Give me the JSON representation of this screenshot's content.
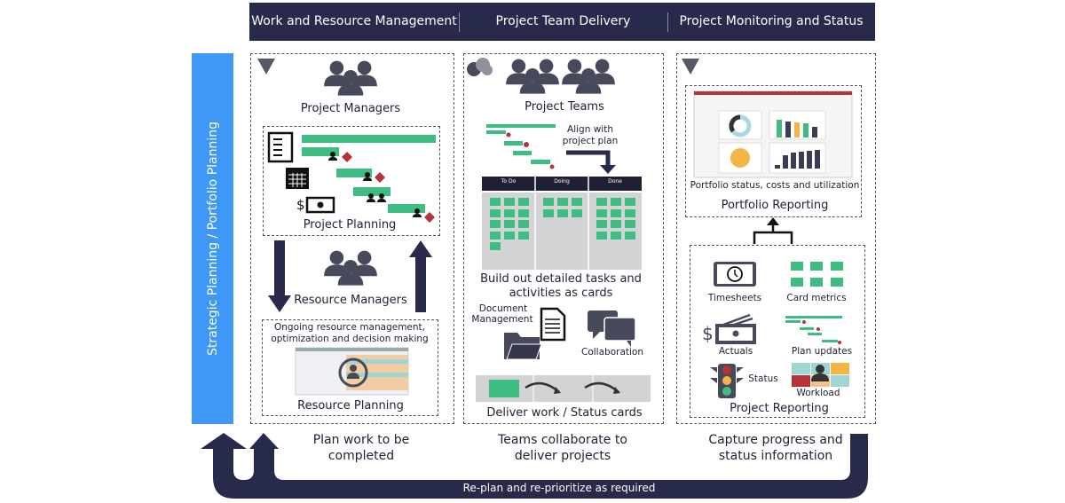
{
  "header": {
    "columns": [
      "Work and Resource Management",
      "Project Team Delivery",
      "Project Monitoring and Status"
    ]
  },
  "sidebar": {
    "label": "Strategic Planning / Portfolio Planning"
  },
  "col1": {
    "project_managers": "Project Managers",
    "project_planning": "Project Planning",
    "resource_managers": "Resource Managers",
    "resource_desc_1": "Ongoing resource management,",
    "resource_desc_2": "optimization and decision making",
    "resource_planning": "Resource Planning",
    "caption_1": "Plan work to be",
    "caption_2": "completed"
  },
  "col2": {
    "project_teams": "Project Teams",
    "align_1": "Align with",
    "align_2": "project plan",
    "kanban": [
      "To Do",
      "Doing",
      "Done"
    ],
    "build_1": "Build out detailed tasks and",
    "build_2": "activities as cards",
    "doc_1": "Document",
    "doc_2": "Management",
    "collaboration": "Collaboration",
    "deliver": "Deliver work / Status cards",
    "caption_1": "Teams collaborate to",
    "caption_2": "deliver projects"
  },
  "col3": {
    "portfolio_desc": "Portfolio status, costs and utilization",
    "portfolio_reporting": "Portfolio Reporting",
    "timesheets": "Timesheets",
    "card_metrics": "Card metrics",
    "actuals": "Actuals",
    "plan_updates": "Plan updates",
    "status": "Status",
    "workload": "Workload",
    "project_reporting": "Project Reporting",
    "caption_1": "Capture progress and",
    "caption_2": "status information"
  },
  "loop": {
    "label": "Re-plan and re-prioritize as required"
  },
  "colors": {
    "navy": "#272a4a",
    "blue": "#3f97f6",
    "green": "#3dbd82",
    "icon_gray": "#474a5a",
    "milestone": "#b8323a"
  }
}
